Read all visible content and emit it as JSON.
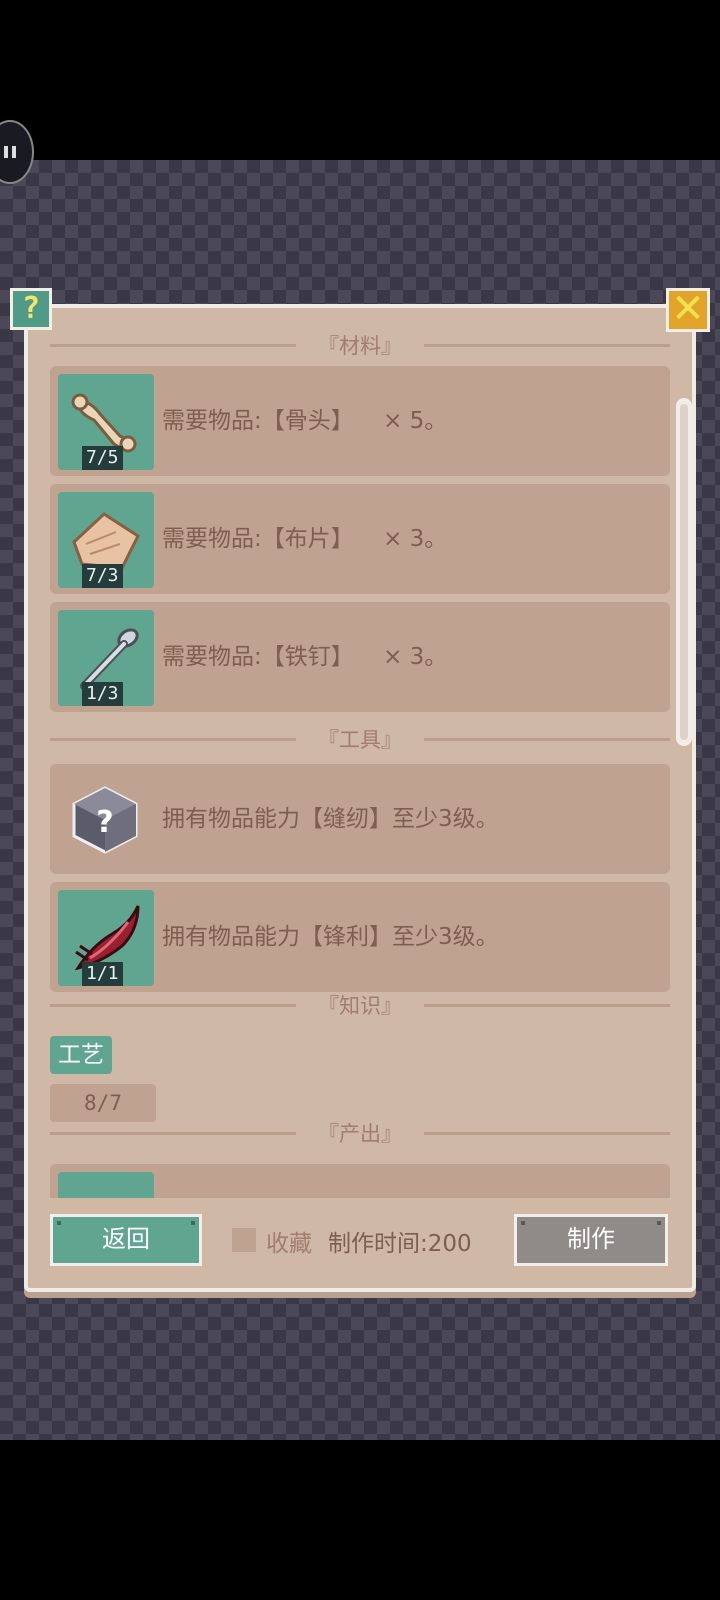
{
  "header": {
    "help_label": "?",
    "close_label": "✕"
  },
  "sections": {
    "materials": "『材料』",
    "tools": "『工具』",
    "knowledge": "『知识』",
    "output": "『产出』"
  },
  "materials": [
    {
      "icon": "bone-icon",
      "count": "7/5",
      "text": "需要物品:【骨头】",
      "qty": "× 5。"
    },
    {
      "icon": "cloth-icon",
      "count": "7/3",
      "text": "需要物品:【布片】",
      "qty": "× 3。"
    },
    {
      "icon": "iron-nail-icon",
      "count": "1/3",
      "text": "需要物品:【铁钉】",
      "qty": "× 3。"
    }
  ],
  "tools": [
    {
      "icon": "unknown-cube-icon",
      "count": "",
      "text": "拥有物品能力【缝纫】至少3级。"
    },
    {
      "icon": "claw-blade-icon",
      "count": "1/1",
      "text": "拥有物品能力【锋利】至少3级。"
    }
  ],
  "knowledge": {
    "tag": "工艺",
    "progress": "8/7"
  },
  "footer": {
    "back_label": "返回",
    "favorite_label": "收藏",
    "time_label": "制作时间:200",
    "make_label": "制作"
  },
  "colors": {
    "panel_bg": "#d0b8a6",
    "row_bg": "#bfa390",
    "accent_teal": "#5fa590",
    "text_brown": "#7e5e50",
    "disabled_gray": "#8e8b88"
  }
}
